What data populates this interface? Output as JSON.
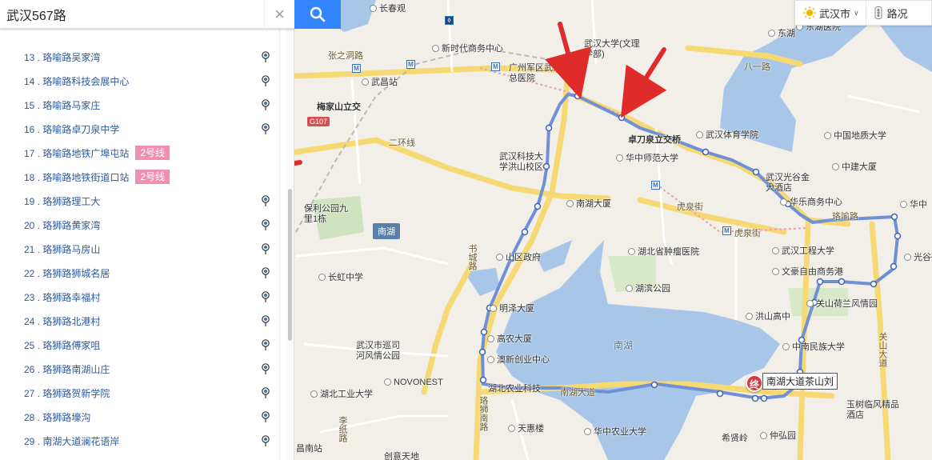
{
  "search": {
    "query": "武汉567路",
    "clear_icon": "×"
  },
  "stops": [
    {
      "label": "13 . 珞喻路吴家湾",
      "tag": ""
    },
    {
      "label": "14 . 珞喻路科技会展中心",
      "tag": ""
    },
    {
      "label": "15 . 珞喻路马家庄",
      "tag": ""
    },
    {
      "label": "16 . 珞喻路卓刀泉中学",
      "tag": ""
    },
    {
      "label": "17 . 珞喻路地铁广埠屯站",
      "tag": "2号线"
    },
    {
      "label": "18 . 珞喻路地铁街道口站",
      "tag": "2号线"
    },
    {
      "label": "19 . 珞狮路理工大",
      "tag": ""
    },
    {
      "label": "20 . 珞狮路黄家湾",
      "tag": ""
    },
    {
      "label": "21 . 珞狮路马房山",
      "tag": ""
    },
    {
      "label": "22 . 珞狮路狮城名居",
      "tag": ""
    },
    {
      "label": "23 . 珞狮路幸福村",
      "tag": ""
    },
    {
      "label": "24 . 珞狮路北港村",
      "tag": ""
    },
    {
      "label": "25 . 珞狮路傅家咀",
      "tag": ""
    },
    {
      "label": "26 . 珞狮路南湖山庄",
      "tag": ""
    },
    {
      "label": "27 . 珞狮路贺新学院",
      "tag": ""
    },
    {
      "label": "28 . 珞狮路壕沟",
      "tag": ""
    },
    {
      "label": "29 . 南湖大道澜花语岸",
      "tag": ""
    }
  ],
  "controls": {
    "city": "武汉市",
    "traffic": "路况"
  },
  "map_labels": {
    "wuchang_station": "武昌站",
    "zhang_zhi_dong_road": "张之洞路",
    "changchun_temple": "长春观",
    "new_era_center": "新时代商务中心",
    "guangzhou_hospital": "广州军区武汉总医院",
    "whu": "武汉大学(文理学部)",
    "bayi_road": "八一路",
    "dongting": "东湖",
    "donghu_hospital": "东湖医院",
    "meijiashan": "梅家山立交",
    "g107": "G107",
    "second_ring": "二环线",
    "wust": "武汉科技大学洪山校区",
    "ccnu": "华中师范大学",
    "zhuodaoquan": "卓刀泉立交桥",
    "sports_college": "武汉体育学院",
    "cug": "中国地质大学",
    "zhongjian": "中建大厦",
    "optics_hotel": "武汉光谷金大酒店",
    "hualee": "华乐商务中心",
    "nanhu_building": "南湖大厦",
    "baoli": "保利公园九里1栋",
    "nanhu": "南湖",
    "shucheng_road": "书城路",
    "shanqu_gov": "山区政府",
    "hupei_cancer": "湖北省肿瘤医院",
    "hubin_park": "湖滨公园",
    "wit": "武汉工程大学",
    "wenhao": "文豪自由商务港",
    "changhong": "长虹中学",
    "mingze": "明泽大厦",
    "gaonong": "高农大厦",
    "xiangxin": "澳新创业中心",
    "wuhan_park": "武汉市巡司河风情公园",
    "novonest": "NOVONEST",
    "hubei_tech": "湖北工业大学",
    "hubei_agri": "湖北农业科技",
    "tianhui": "天惠楼",
    "hzau": "华中农业大学",
    "luoshi_south": "珞狮南路",
    "lixin_road": "李纸路",
    "nanhu_lake": "南湖",
    "hongshan_high": "洪山高中",
    "guanshan": "关山荷兰风情园",
    "scuec": "中南民族大学",
    "huazhong_mid": "华中",
    "guanggu": "光谷街",
    "guanshan_ave": "关山大道",
    "yudai": "玉树临风精品酒店",
    "xixianling": "希贤岭",
    "zhonghong": "仲弘园",
    "terminal": "南湖大道茶山刘",
    "terminal_badge": "终",
    "huquan_street": "虎泉街",
    "luoyu_road": "珞喻路",
    "nanhu_ave": "南湖大道",
    "changnan_station": "昌南站",
    "chuangtian": "创意天地"
  }
}
